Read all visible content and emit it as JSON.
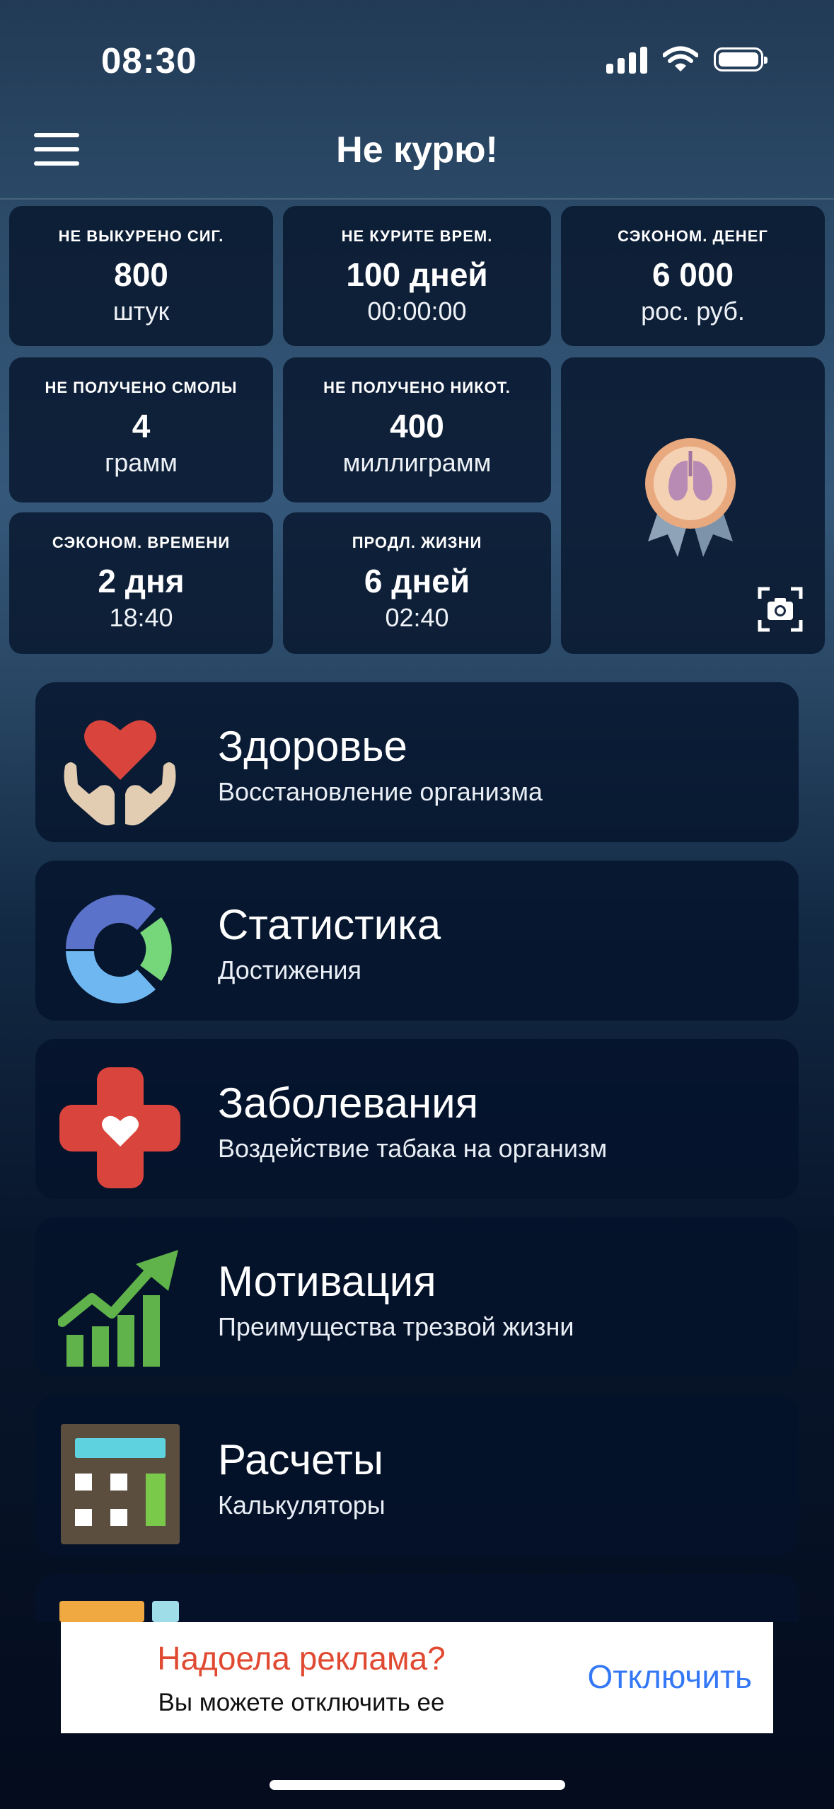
{
  "status_bar": {
    "time": "08:30"
  },
  "navbar": {
    "title": "Не курю!",
    "menu_icon": "hamburger-icon"
  },
  "stats": {
    "cigarettes": {
      "label": "НЕ ВЫКУРЕНО СИГ.",
      "value": "800",
      "unit": "штук"
    },
    "time": {
      "label": "НЕ КУРИТЕ ВРЕМ.",
      "value": "100 дней",
      "unit": "00:00:00"
    },
    "money": {
      "label": "СЭКОНОМ. ДЕНЕГ",
      "value": "6 000",
      "unit": "рос. руб."
    },
    "tar": {
      "label": "НЕ ПОЛУЧЕНО СМОЛЫ",
      "value": "4",
      "unit": "грамм"
    },
    "nicotine": {
      "label": "НЕ ПОЛУЧЕНО НИКОТ.",
      "value": "400",
      "unit": "миллиграмм"
    },
    "saved_time": {
      "label": "СЭКОНОМ. ВРЕМЕНИ",
      "value": "2 дня",
      "unit": "18:40"
    },
    "life": {
      "label": "ПРОДЛ. ЖИЗНИ",
      "value": "6 дней",
      "unit": "02:40"
    }
  },
  "achievement": {
    "badge_icon": "lungs-medal-icon",
    "screenshot_icon": "camera-capture-icon"
  },
  "menu": [
    {
      "title": "Здоровье",
      "subtitle": "Восстановление организма",
      "icon": "heart-hands-icon"
    },
    {
      "title": "Статистика",
      "subtitle": "Достижения",
      "icon": "donut-chart-icon"
    },
    {
      "title": "Заболевания",
      "subtitle": "Воздействие табака на организм",
      "icon": "medical-cross-icon"
    },
    {
      "title": "Мотивация",
      "subtitle": "Преимущества трезвой жизни",
      "icon": "growth-chart-icon"
    },
    {
      "title": "Расчеты",
      "subtitle": "Калькуляторы",
      "icon": "calculator-icon"
    }
  ],
  "ad": {
    "title": "Надоела реклама?",
    "subtitle": "Вы можете отключить ее",
    "button": "Отключить"
  },
  "colors": {
    "ad_title": "#e04a32",
    "ad_button": "#3478f6",
    "heart_red": "#d9453d"
  }
}
